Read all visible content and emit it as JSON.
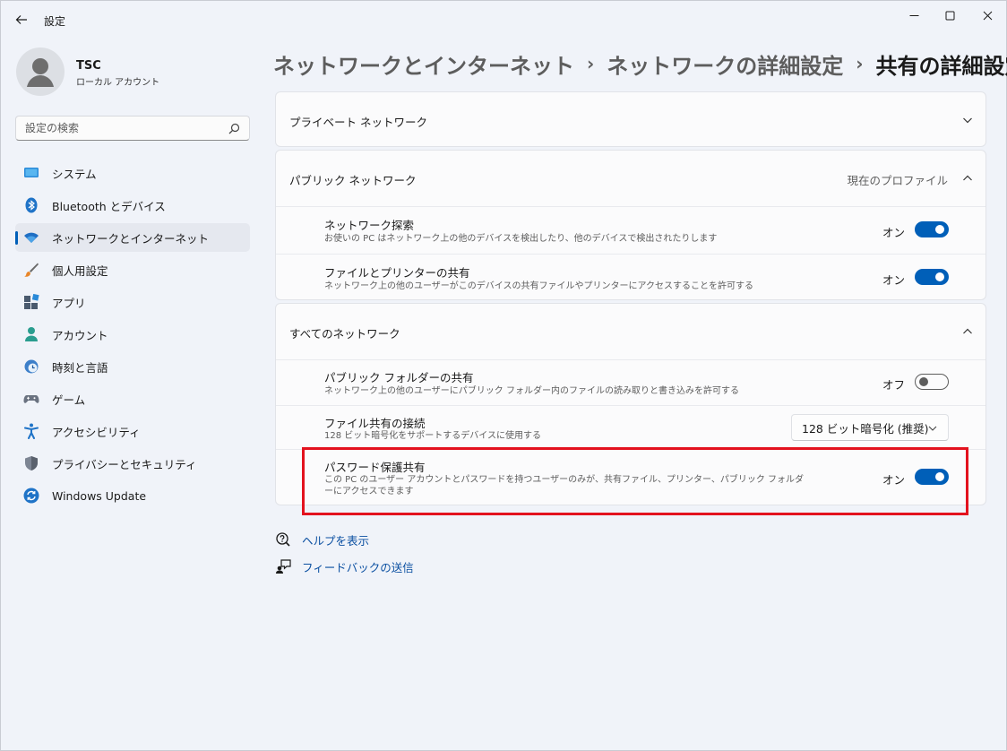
{
  "window": {
    "title": "設定",
    "accent": "#005fb8"
  },
  "user": {
    "name": "TSC",
    "account_type": "ローカル アカウント"
  },
  "search": {
    "placeholder": "設定の検索"
  },
  "sidebar": {
    "items": [
      {
        "label": "システム",
        "icon": "monitor-icon",
        "selected": false
      },
      {
        "label": "Bluetooth とデバイス",
        "icon": "bluetooth-icon",
        "selected": false
      },
      {
        "label": "ネットワークとインターネット",
        "icon": "wifi-icon",
        "selected": true
      },
      {
        "label": "個人用設定",
        "icon": "brush-icon",
        "selected": false
      },
      {
        "label": "アプリ",
        "icon": "apps-icon",
        "selected": false
      },
      {
        "label": "アカウント",
        "icon": "person-icon",
        "selected": false
      },
      {
        "label": "時刻と言語",
        "icon": "clock-globe-icon",
        "selected": false
      },
      {
        "label": "ゲーム",
        "icon": "gamepad-icon",
        "selected": false
      },
      {
        "label": "アクセシビリティ",
        "icon": "accessibility-icon",
        "selected": false
      },
      {
        "label": "プライバシーとセキュリティ",
        "icon": "shield-icon",
        "selected": false
      },
      {
        "label": "Windows Update",
        "icon": "update-icon",
        "selected": false
      }
    ]
  },
  "breadcrumb": {
    "items": [
      "ネットワークとインターネット",
      "ネットワークの詳細設定",
      "共有の詳細設定"
    ]
  },
  "sections": {
    "private": {
      "title": "プライベート ネットワーク"
    },
    "public": {
      "title": "パブリック ネットワーク",
      "profile_label": "現在のプロファイル",
      "settings": [
        {
          "title": "ネットワーク探索",
          "description": "お使いの PC はネットワーク上の他のデバイスを検出したり、他のデバイスで検出されたりします",
          "state_label": "オン",
          "on": true
        },
        {
          "title": "ファイルとプリンターの共有",
          "description": "ネットワーク上の他のユーザーがこのデバイスの共有ファイルやプリンターにアクセスすることを許可する",
          "state_label": "オン",
          "on": true
        }
      ]
    },
    "all": {
      "title": "すべてのネットワーク",
      "public_folder": {
        "title": "パブリック フォルダーの共有",
        "description": "ネットワーク上の他のユーザーにパブリック フォルダー内のファイルの読み取りと書き込みを許可する",
        "state_label": "オフ",
        "on": false
      },
      "file_sharing": {
        "title": "ファイル共有の接続",
        "description": "128 ビット暗号化をサポートするデバイスに使用する",
        "selected_value": "128 ビット暗号化 (推奨)"
      },
      "password_protected": {
        "title": "パスワード保護共有",
        "description": "この PC のユーザー アカウントとパスワードを持つユーザーのみが、共有ファイル、プリンター、パブリック フォルダーにアクセスできます",
        "state_label": "オン",
        "on": true
      }
    }
  },
  "footer": {
    "help_label": "ヘルプを表示",
    "feedback_label": "フィードバックの送信"
  },
  "highlight_color": "#e3121e"
}
